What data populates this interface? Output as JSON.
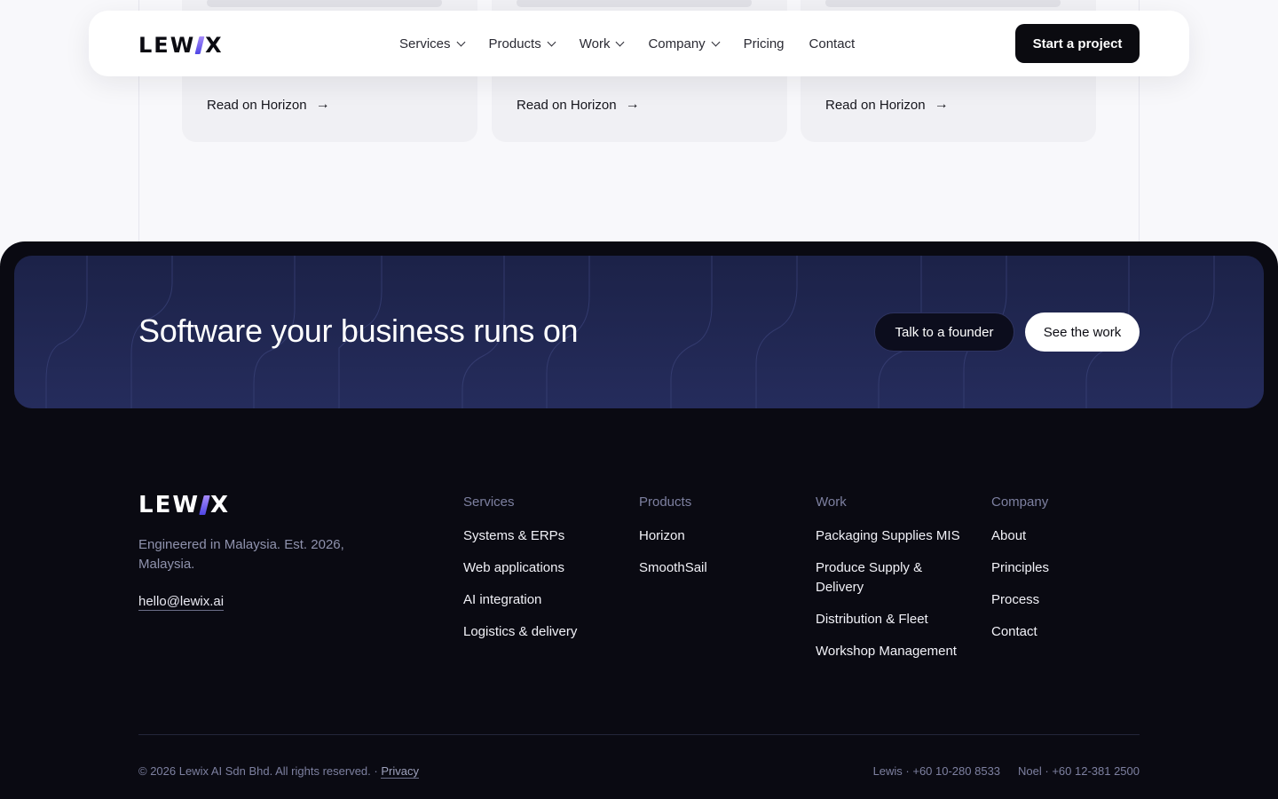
{
  "nav": {
    "logo": "LEWIX",
    "items": [
      {
        "label": "Services"
      },
      {
        "label": "Products"
      },
      {
        "label": "Work"
      },
      {
        "label": "Company"
      },
      {
        "label": "Pricing"
      },
      {
        "label": "Contact"
      }
    ],
    "cta_label": "Start a project"
  },
  "cards": {
    "read_link": "Read on Horizon",
    "arrow": "→"
  },
  "cta": {
    "title": "Software your business runs on",
    "founder_label": "Talk to a founder",
    "work_label": "See the work"
  },
  "footer": {
    "logo": "LEWIX",
    "tagline": "Engineered in Malaysia. Est. 2026, Malaysia.",
    "email": "hello@lewix.ai",
    "columns": [
      {
        "heading": "Services",
        "links": [
          "Systems & ERPs",
          "Web applications",
          "AI integration",
          "Logistics & delivery"
        ]
      },
      {
        "heading": "Products",
        "links": [
          "Horizon",
          "SmoothSail"
        ]
      },
      {
        "heading": "Work",
        "links": [
          "Packaging Supplies MIS",
          "Produce Supply & Delivery",
          "Distribution & Fleet",
          "Workshop Management"
        ]
      },
      {
        "heading": "Company",
        "links": [
          "About",
          "Principles",
          "Process",
          "Contact"
        ]
      }
    ],
    "copyright": "© 2026 Lewix AI Sdn Bhd. All rights reserved. · ",
    "privacy": "Privacy",
    "contact_lewis": "Lewis · +60 10-280 8533",
    "contact_noel": "Noel · +60 12-381 2500"
  },
  "colors": {
    "footer_bg": "#0a0a12",
    "cta_bg": "#252c5c",
    "accent": "#4f46e5",
    "primary_button": "#0b0b10"
  }
}
